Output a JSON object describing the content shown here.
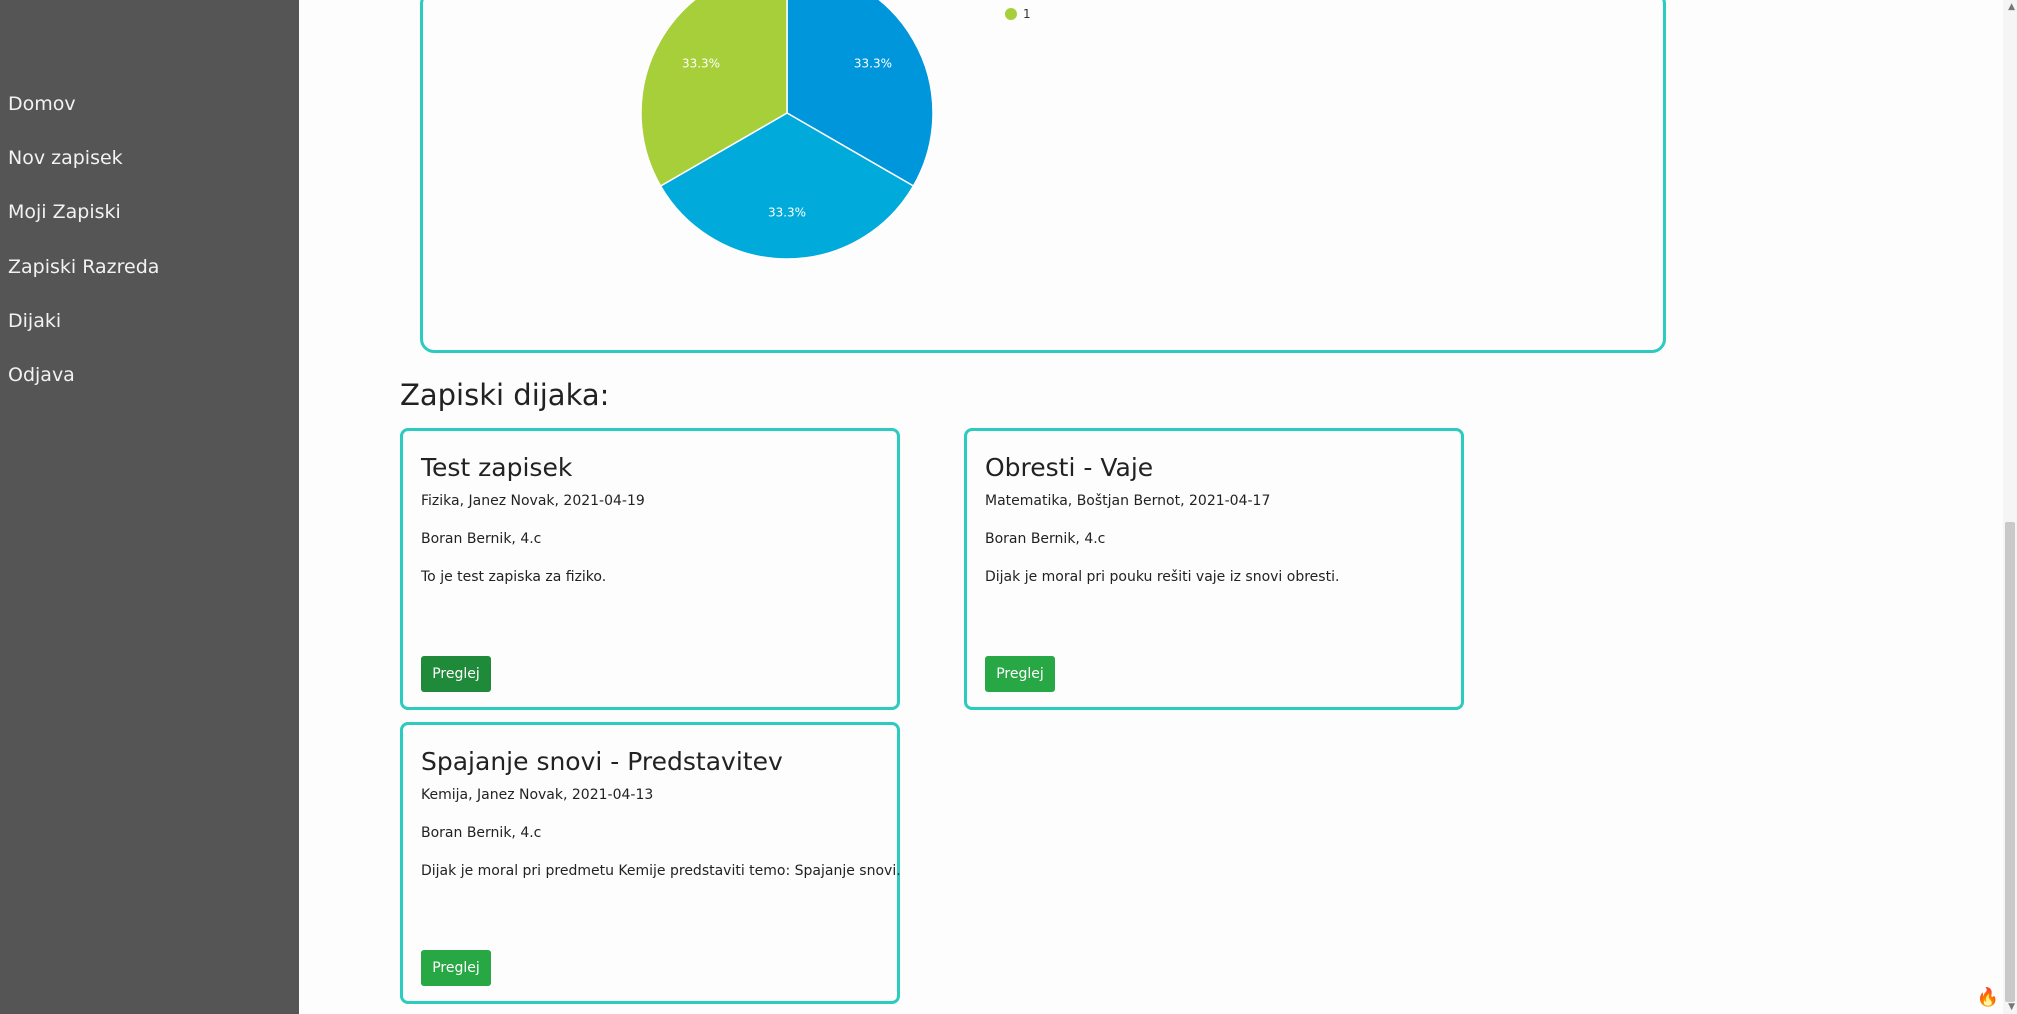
{
  "sidebar": {
    "items": [
      {
        "label": "Domov"
      },
      {
        "label": "Nov zapisek"
      },
      {
        "label": "Moji Zapiski"
      },
      {
        "label": "Zapiski Razreda"
      },
      {
        "label": "Dijaki"
      },
      {
        "label": "Odjava"
      }
    ]
  },
  "chart_data": {
    "type": "pie",
    "slices": [
      {
        "label": "33.3%",
        "value": 33.3,
        "color": "#0096db"
      },
      {
        "label": "33.3%",
        "value": 33.3,
        "color": "#00abdb"
      },
      {
        "label": "33.3%",
        "value": 33.3,
        "color": "#a6cf3a"
      }
    ],
    "legend": [
      {
        "label": "1",
        "color": "#a6cf3a"
      }
    ]
  },
  "section": {
    "title": "Zapiski dijaka:"
  },
  "cards": [
    {
      "title": "Test zapisek",
      "meta": "Fizika, Janez Novak, 2021-04-19",
      "student": "Boran Bernik, 4.c",
      "description": "To je test zapiska za fiziko.",
      "button": "Preglej"
    },
    {
      "title": "Obresti - Vaje",
      "meta": "Matematika, Boštjan Bernot, 2021-04-17",
      "student": "Boran Bernik, 4.c",
      "description": "Dijak je moral pri pouku rešiti vaje iz snovi obresti.",
      "button": "Preglej"
    },
    {
      "title": "Spajanje snovi - Predstavitev",
      "meta": "Kemija, Janez Novak, 2021-04-13",
      "student": "Boran Bernik, 4.c",
      "description": "Dijak je moral pri predmetu Kemije predstaviti temo: Spajanje snovi.",
      "button": "Preglej"
    }
  ],
  "colors": {
    "sidebar_bg": "#555555",
    "card_border": "#2ccbbf",
    "button_bg": "#28a745"
  }
}
